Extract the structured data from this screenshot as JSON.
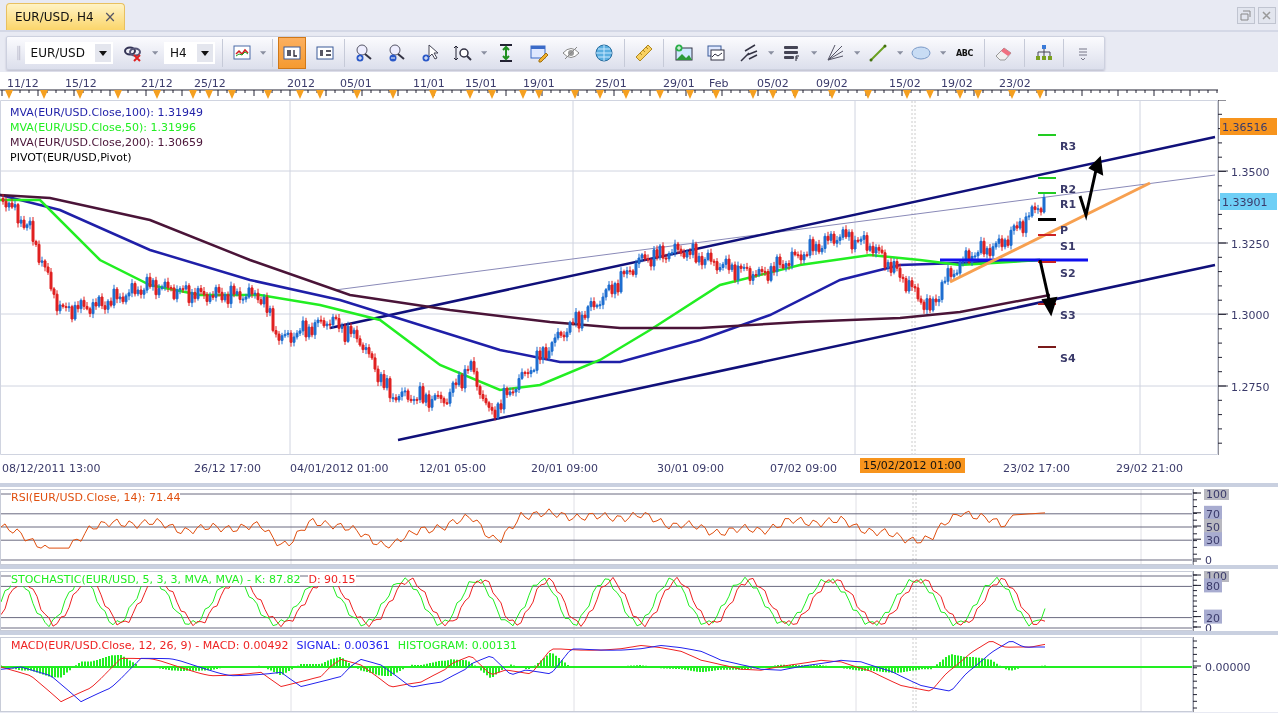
{
  "tab": {
    "title": "EUR/USD, H4",
    "close": "×"
  },
  "toolbar": {
    "items": [
      {
        "kind": "dropdown",
        "value": "EUR/USD"
      },
      {
        "kind": "link",
        "menu": true,
        "selected": false
      },
      {
        "kind": "dropdown",
        "value": "H4"
      },
      {
        "kind": "separator"
      },
      {
        "kind": "chart",
        "menu": true,
        "selected": false
      },
      {
        "kind": "separator"
      },
      {
        "kind": "bars",
        "menu": false,
        "selected": true
      },
      {
        "kind": "table",
        "menu": false,
        "selected": false
      },
      {
        "kind": "separator"
      },
      {
        "kind": "zoom-in",
        "menu": false,
        "selected": false
      },
      {
        "kind": "zoom-out",
        "menu": false,
        "selected": false
      },
      {
        "kind": "pointer",
        "menu": false,
        "selected": false
      },
      {
        "kind": "zoom-range",
        "menu": true,
        "selected": false
      },
      {
        "kind": "fit",
        "menu": false,
        "selected": false
      },
      {
        "kind": "properties",
        "menu": false,
        "selected": false
      },
      {
        "kind": "eye",
        "menu": false,
        "selected": false
      },
      {
        "kind": "globe",
        "menu": false,
        "selected": false
      },
      {
        "kind": "separator"
      },
      {
        "kind": "ruler",
        "menu": false,
        "selected": false
      },
      {
        "kind": "separator"
      },
      {
        "kind": "image",
        "menu": false,
        "selected": false
      },
      {
        "kind": "windows",
        "menu": false,
        "selected": false
      },
      {
        "kind": "pitchfork",
        "menu": true,
        "selected": false
      },
      {
        "kind": "lines",
        "menu": true,
        "selected": false
      },
      {
        "kind": "fan",
        "menu": true,
        "selected": false
      },
      {
        "kind": "line",
        "menu": true,
        "selected": false
      },
      {
        "kind": "ellipse",
        "menu": true,
        "selected": false
      },
      {
        "kind": "text",
        "glyph": "ABC",
        "menu": false,
        "selected": false
      },
      {
        "kind": "separator"
      },
      {
        "kind": "eraser",
        "menu": false,
        "selected": false
      },
      {
        "kind": "separator"
      },
      {
        "kind": "tree",
        "menu": false,
        "selected": false
      },
      {
        "kind": "separator"
      },
      {
        "kind": "overflow",
        "menu": false,
        "selected": false
      }
    ]
  },
  "top_axis": [
    "11/12",
    "15/12",
    "21/12",
    "25/12",
    "2012",
    "05/01",
    "11/01",
    "15/01",
    "19/01",
    "25/01",
    "29/01",
    "Feb",
    "05/02",
    "09/02",
    "15/02",
    "19/02",
    "23/02"
  ],
  "main_chart": {
    "legend": [
      {
        "text": "MVA(EUR/USD.Close,100): 1.31949",
        "color": "#1f1fa8"
      },
      {
        "text": "MVA(EUR/USD.Close,50): 1.31996",
        "color": "#22ee22"
      },
      {
        "text": "MVA(EUR/USD.Close,200): 1.30659",
        "color": "#4a1438"
      },
      {
        "text": "PIVOT(EUR/USD,Pivot)",
        "color": "#000000"
      }
    ],
    "pivots": [
      {
        "label": "R3",
        "color": "#22cc22"
      },
      {
        "label": "R2",
        "color": "#22cc22"
      },
      {
        "label": "R1",
        "color": "#22cc22"
      },
      {
        "label": "P",
        "color": "#000000"
      },
      {
        "label": "S1",
        "color": "#cc2222"
      },
      {
        "label": "S2",
        "color": "#cc2222"
      },
      {
        "label": "S3",
        "color": "#aa2222"
      },
      {
        "label": "S4",
        "color": "#7a1a1a"
      }
    ],
    "y_axis": [
      "1.3500",
      "1.3250",
      "1.3000",
      "1.2750"
    ],
    "price_badges": [
      {
        "text": "1.36516",
        "color": "#f7941d"
      },
      {
        "text": "1.33901",
        "color": "#6ecff6"
      }
    ]
  },
  "bottom_axis": {
    "labels": [
      "08/12/2011 13:00",
      "26/12 17:00",
      "04/01/2012 01:00",
      "12/01 05:00",
      "20/01 09:00",
      "30/01 09:00",
      "07/02 09:00",
      "23/02 17:00",
      "29/02 21:00"
    ],
    "cursor": "15/02/2012 01:00"
  },
  "indicators": [
    {
      "kind": "rsi",
      "title": [
        {
          "text": "RSI(EUR/USD.Close, 14): 71.44",
          "color": "#e05010"
        }
      ],
      "axis": [
        "100",
        "70",
        "50",
        "30",
        "0"
      ]
    },
    {
      "kind": "stochastic",
      "title": [
        {
          "text": "STOCHASTIC(EUR/USD, 5, 3, 3, MVA, MVA) -  K: 87.82",
          "color": "#22ee22"
        },
        {
          "text": "D: 90.15",
          "color": "#ee2222"
        }
      ],
      "axis": [
        "100",
        "80",
        "20",
        "0"
      ]
    },
    {
      "kind": "macd",
      "title": [
        {
          "text": "MACD(EUR/USD.Close, 12, 26, 9) -  MACD: 0.00492",
          "color": "#ee2222"
        },
        {
          "text": "SIGNAL: 0.00361",
          "color": "#2222ee"
        },
        {
          "text": "HISTOGRAM: 0.00131",
          "color": "#22ee22"
        }
      ],
      "axis": [
        "0.00000"
      ]
    }
  ]
}
